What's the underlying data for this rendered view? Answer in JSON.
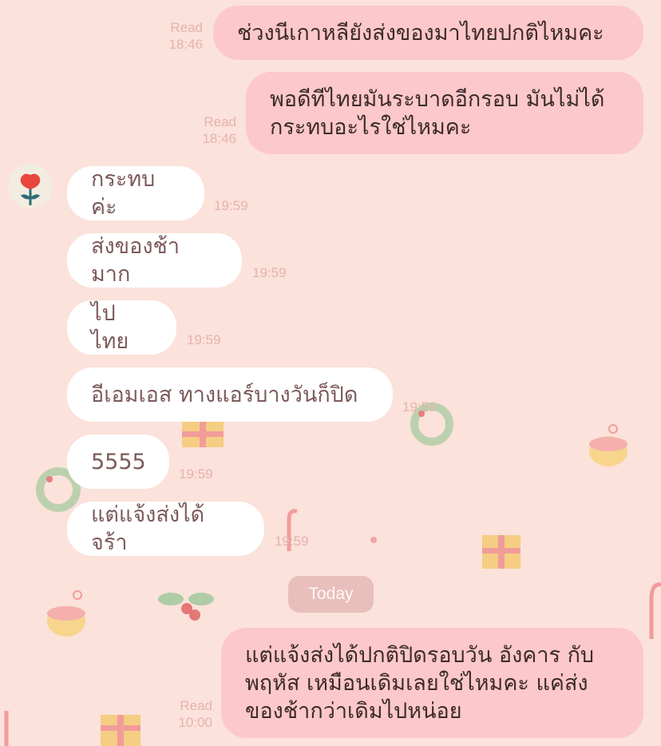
{
  "messages": [
    {
      "dir": "out",
      "status": "Read",
      "time": "18:46",
      "lines": [
        "ช่วงนีเกาหลียังส่งของมาไทยปกติไหมคะ"
      ]
    },
    {
      "dir": "out",
      "status": "Read",
      "time": "18:46",
      "lines": [
        "พอดีทีไทยมันระบาดอีกรอบ มันไม่ได้",
        "กระทบอะไรใช่ไหมคะ"
      ]
    },
    {
      "dir": "in",
      "time": "19:59",
      "lines": [
        "กระทบค่ะ"
      ]
    },
    {
      "dir": "in",
      "time": "19:59",
      "lines": [
        "ส่งของช้ามาก"
      ]
    },
    {
      "dir": "in",
      "time": "19:59",
      "lines": [
        "ไปไทย"
      ]
    },
    {
      "dir": "in",
      "time": "19:59",
      "lines": [
        "อีเอมเอส ทางแอร์บางวันก็ปิด"
      ]
    },
    {
      "dir": "in",
      "time": "19:59",
      "lines": [
        "5555"
      ]
    },
    {
      "dir": "in",
      "time": "19:59",
      "lines": [
        "แต่แจ้งส่งได้จร้า"
      ]
    },
    {
      "dir": "out",
      "status": "Read",
      "time": "10:00",
      "lines": [
        "แต่แจ้งส่งได้ปกติปิดรอบวัน อังคาร กับ",
        "พฤหัส เหมือนเดิมเลยใช่ไหมคะ แค่ส่ง",
        "ของช้ากว่าเดิมไปหน่อย"
      ]
    }
  ],
  "date_divider": "Today",
  "icons": {
    "avatar": "red-flower-avatar-icon"
  },
  "colors": {
    "background": "#fbe2da",
    "outgoing": "#fcc8c9",
    "incoming": "#ffffff"
  }
}
